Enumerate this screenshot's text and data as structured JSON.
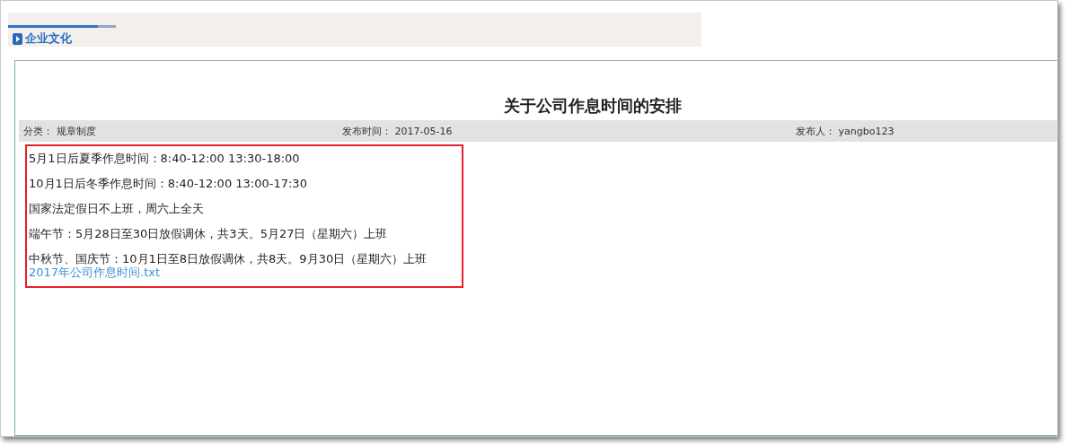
{
  "section": {
    "title": "企业文化"
  },
  "article": {
    "title": "关于公司作息时间的安排",
    "meta": [
      {
        "label": "分类：",
        "value": "规章制度"
      },
      {
        "label": "发布时间：",
        "value": "2017-05-16"
      },
      {
        "label": "发布人：",
        "value": "yangbo123"
      }
    ],
    "lines": [
      "5月1日后夏季作息时间：8:40-12:00 13:30-18:00",
      "10月1日后冬季作息时间：8:40-12:00 13:00-17:30",
      "国家法定假日不上班，周六上全天",
      "端午节：5月28日至30日放假调休，共3天。5月27日（星期六）上班",
      "中秋节、国庆节：10月1日至8日放假调休，共8天。9月30日（星期六）上班"
    ],
    "attachment": "2017年公司作息时间.txt"
  }
}
